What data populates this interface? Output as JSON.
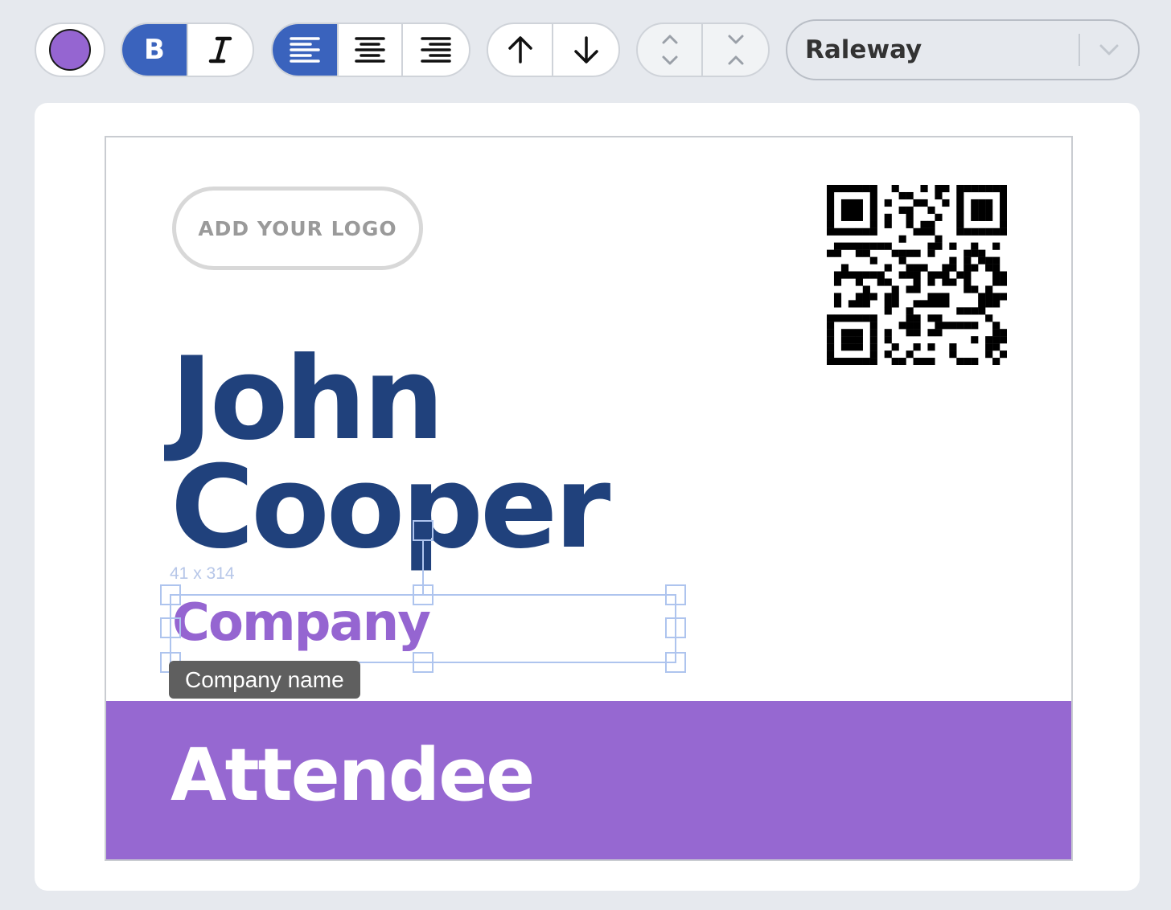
{
  "toolbar": {
    "color": {
      "value": "#9565d1",
      "icon": "color-swatch"
    },
    "bold_label": "B",
    "italic_icon": "italic-icon",
    "align": {
      "active": "left",
      "options": [
        "left",
        "center",
        "right"
      ]
    },
    "layer_icons": [
      "arrow-up-icon",
      "arrow-down-icon"
    ],
    "spacing_icons": [
      "expand-vertical-icon",
      "collapse-vertical-icon"
    ],
    "font": {
      "value": "Raleway",
      "icon": "chevron-down-icon"
    }
  },
  "badge": {
    "logo_placeholder": "ADD YOUR LOGO",
    "qr_icon": "qr-code",
    "first_name": "John",
    "last_name": "Cooper",
    "company": "Company",
    "role": "Attendee",
    "accent_color": "#9668d1",
    "name_color": "#20417c"
  },
  "selection": {
    "dimensions": "41 x 314",
    "tooltip": "Company name"
  }
}
